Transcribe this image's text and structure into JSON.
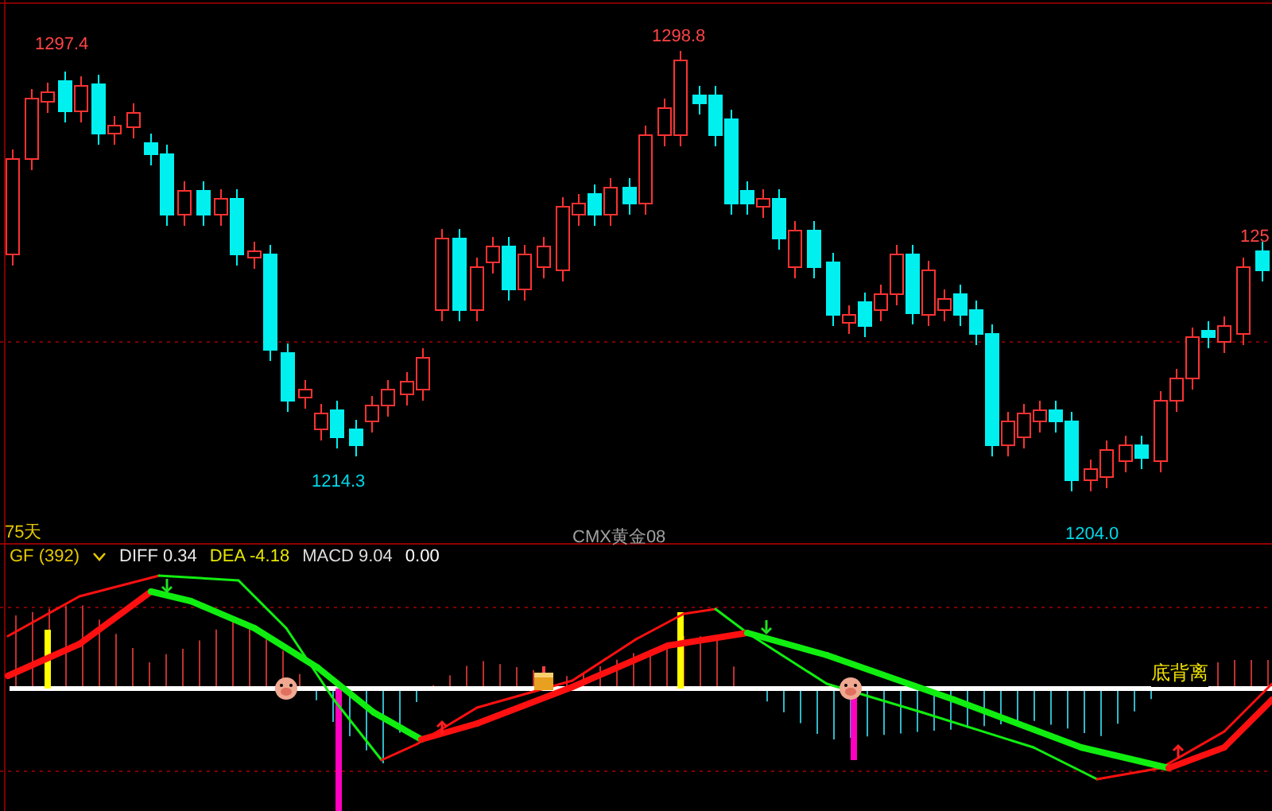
{
  "price_chart": {
    "period_label": "75天",
    "symbol": "CMX黄金08",
    "price_labels": [
      {
        "text": "1297.4",
        "kind": "high"
      },
      {
        "text": "1298.8",
        "kind": "high"
      },
      {
        "text": "1214.3",
        "kind": "low"
      },
      {
        "text": "1204.0",
        "kind": "low"
      },
      {
        "text": "125",
        "kind": "high"
      }
    ]
  },
  "indicator": {
    "name": "GF (392)",
    "values": [
      {
        "text": "DIFF 0.34",
        "color": "#e8e8e8"
      },
      {
        "text": "DEA -4.18",
        "color": "#e6e600"
      },
      {
        "text": "MACD 9.04",
        "color": "#dcdcdc"
      },
      {
        "text": "0.00",
        "color": "#ffffff"
      }
    ],
    "signal_label": "底背离"
  }
}
